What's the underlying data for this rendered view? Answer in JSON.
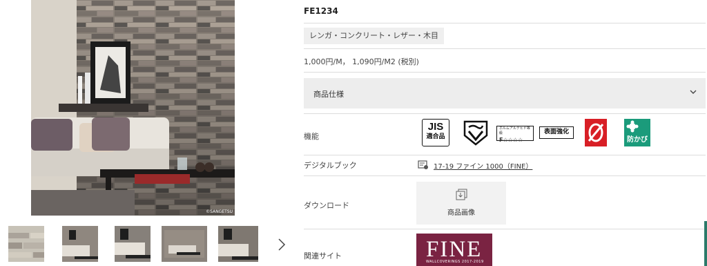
{
  "gallery": {
    "copyright": "©SANGETSU",
    "thumbnails": [
      {
        "alt": "wall texture close-up"
      },
      {
        "alt": "room view 1"
      },
      {
        "alt": "room view 2"
      },
      {
        "alt": "room view 3"
      },
      {
        "alt": "room view 4"
      }
    ],
    "next_icon": "chevron-right-icon"
  },
  "product": {
    "code": "FE1234",
    "tag": "レンガ・コンクリート・レザー・木目",
    "price": "1,000円/M， 1,090円/M2 (税別)",
    "spec_label": "商品仕様",
    "rows": {
      "features_label": "機能",
      "digital_book_label": "デジタルブック",
      "download_label": "ダウンロード",
      "related_label": "関連サイト"
    },
    "features": {
      "jis_top": "JIS",
      "jis_bottom": "適合品",
      "f_small": "ホルムアルデヒド等級",
      "f_stars": "F☆☆☆☆",
      "surface": "表面強化",
      "mold": "防かび"
    },
    "digital_book_link": "17-19 ファイン 1000（FINE）",
    "download_button": "商品画像",
    "related": {
      "logo_text": "FINE",
      "logo_sub": "WALLCOVERINGS 2017-2019"
    }
  },
  "colors": {
    "fire_red": "#d81f26",
    "mold_green": "#1b9b7b",
    "fine_brand": "#7a2342"
  }
}
